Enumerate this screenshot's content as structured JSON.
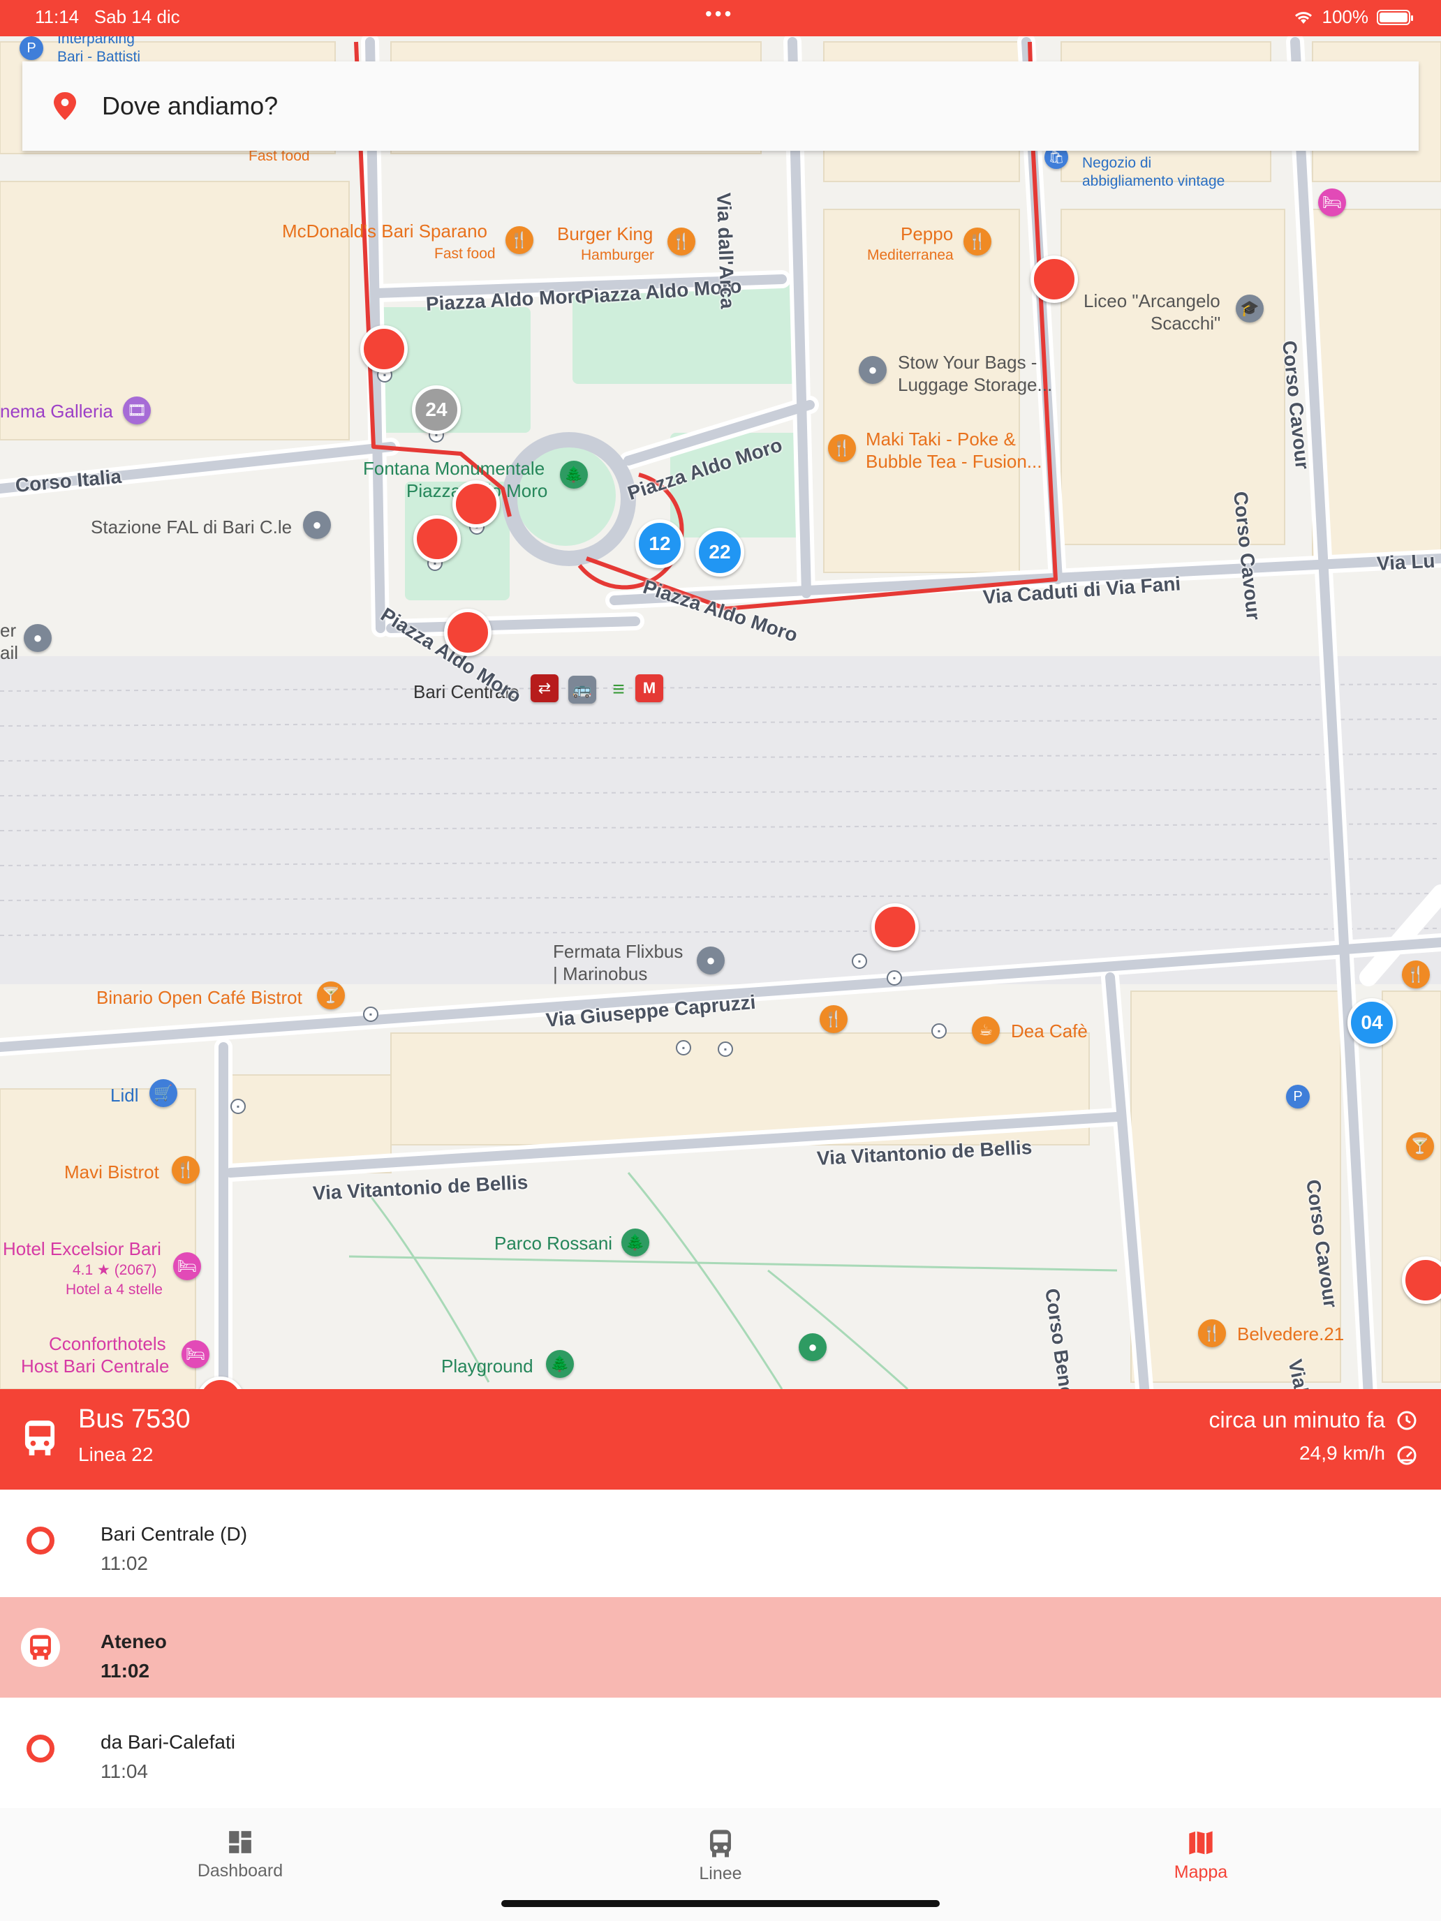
{
  "status_bar": {
    "time": "11:14",
    "date": "Sab 14 dic",
    "battery": "100%"
  },
  "search": {
    "placeholder": "Dove andiamo?"
  },
  "map": {
    "labels": {
      "interparking": "Interparking",
      "bari_battisti": "Bari - Battisti",
      "fast_food_top": "Fast food",
      "mcdonalds": "McDonald's Bari Sparano",
      "mcdonalds_sub": "Fast food",
      "burger_king": "Burger King",
      "burger_king_sub": "Hamburger",
      "peppo": "Peppo",
      "peppo_sub": "Mediterranea",
      "negozio": "Negozio di",
      "negozio2": "abbigliamento vintage",
      "liceo": "Liceo \"Arcangelo",
      "liceo2": "Scacchi\"",
      "stow": "Stow Your Bags -",
      "stow2": "Luggage Storage...",
      "maki": "Maki Taki - Poke &",
      "maki2": "Bubble Tea - Fusion...",
      "cinema": "nema Galleria",
      "fontana": "Fontana Monumentale",
      "fontana2": "Piazza Aldo Moro",
      "stazione_fal": "Stazione FAL di Bari C.le",
      "er": "er",
      "ail": "ail",
      "bari_centrale": "Bari Centrale",
      "fermata_flixbus": "Fermata Flixbus",
      "marinobus": "| Marinobus",
      "binario": "Binario Open Café Bistrot",
      "dea_cafe": "Dea Cafè",
      "lidl": "Lidl",
      "mavi": "Mavi Bistrot",
      "hotel_excelsior": "Hotel Excelsior Bari",
      "hotel_rating": "4.1 ★ (2067)",
      "hotel_type": "Hotel a 4 stelle",
      "cconfort": "Cconforthotels",
      "cconfort2": "Host Bari Centrale",
      "parco_rossani": "Parco Rossani",
      "playground": "Playground",
      "belvedere": "Belvedere.21"
    },
    "roads": {
      "piazza_aldo_moro_1": "Piazza Aldo Moro",
      "piazza_aldo_moro_2": "Piazza Aldo Moro",
      "piazza_aldo_moro_3": "Piazza Aldo Moro",
      "piazza_aldo_moro_4": "Piazza Aldo Moro",
      "piazza_aldo_moro_5": "Piazza Aldo Moro",
      "corso_italia": "Corso Italia",
      "via_caduti": "Via Caduti di Via Fani",
      "via_lu": "Via Lu",
      "via_capruzzi": "Via Giuseppe Capruzzi",
      "via_debellis_1": "Via Vitantonio de Bellis",
      "via_debellis_2": "Via Vitantonio de Bellis",
      "corso_cavour_1": "Corso Cavour",
      "corso_cavour_2": "Corso Cavour",
      "corso_cavour_3": "Corso Cavour",
      "corso_benedetto": "Corso Benedetto Cro",
      "viale_unita": "Viale Unità d",
      "via_dall_arca": "Via dall'Arca"
    },
    "vehicles": {
      "v24": "24",
      "v12": "12",
      "v22": "22",
      "v04": "04"
    }
  },
  "bus": {
    "title": "Bus 7530",
    "line": "Linea 22",
    "updated": "circa un minuto fa",
    "speed": "24,9 km/h"
  },
  "stops": [
    {
      "name": "Bari Centrale (D)",
      "time": "11:02"
    },
    {
      "name": "Ateneo",
      "time": "11:02"
    },
    {
      "name": "da Bari-Calefati",
      "time": "11:04"
    }
  ],
  "nav": {
    "dashboard": "Dashboard",
    "linee": "Linee",
    "mappa": "Mappa"
  },
  "colors": {
    "primary": "#f44336",
    "active_row": "#f8b8b2",
    "vehicle_blue": "#2196f3"
  }
}
